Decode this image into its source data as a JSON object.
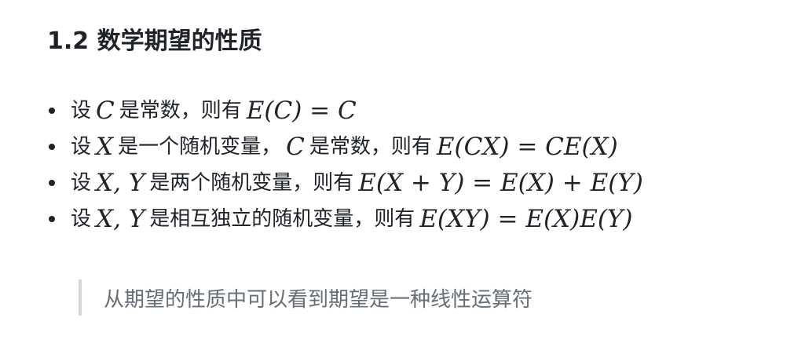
{
  "heading": "1.2 数学期望的性质",
  "items": [
    {
      "prefix": "设",
      "var": "C",
      "text": "是常数，则有",
      "formula": "E(C) = C"
    },
    {
      "prefix": "设",
      "var": "X",
      "text": "是一个随机变量，",
      "var2": "C",
      "text2": "是常数，则有",
      "formula": "E(CX) = CE(X)"
    },
    {
      "prefix": "设",
      "var": "X, Y",
      "text": "是两个随机变量，则有",
      "formula": "E(X + Y) = E(X) + E(Y)"
    },
    {
      "prefix": "设",
      "var": "X, Y",
      "text": "是相互独立的随机变量，则有",
      "formula": "E(XY) = E(X)E(Y)"
    }
  ],
  "quote": "从期望的性质中可以看到期望是一种线性运算符"
}
